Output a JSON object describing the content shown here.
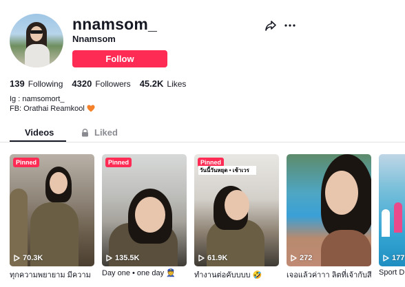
{
  "profile": {
    "username": "nnamsom_",
    "nickname": "Nnamsom",
    "follow_label": "Follow"
  },
  "stats": {
    "following_count": "139",
    "following_label": "Following",
    "followers_count": "4320",
    "followers_label": "Followers",
    "likes_count": "45.2K",
    "likes_label": "Likes"
  },
  "bio": {
    "line1": "Ig : namsomort_",
    "line2": "FB: Orathai Reamkool"
  },
  "tabs": {
    "videos": "Videos",
    "liked": "Liked"
  },
  "videos": [
    {
      "pinned": "Pinned",
      "views": "70.3K",
      "caption": "ทุกความพยายาม มีความ"
    },
    {
      "pinned": "Pinned",
      "views": "135.5K",
      "caption": "Day one • one day 👮"
    },
    {
      "pinned": "Pinned",
      "views": "61.9K",
      "caption": "ทำงานต่อคับบบบ 🤣",
      "overlay_text": "วันนี้วันหยุด • เช้าเวร"
    },
    {
      "views": "272",
      "caption": "เจอแล้วค่าาา ลิตที่เจ้ากับสี"
    },
    {
      "views": "177",
      "caption": "Sport D"
    }
  ],
  "colors": {
    "accent": "#fe2c55",
    "text": "#161823",
    "muted": "#8a8b91"
  }
}
